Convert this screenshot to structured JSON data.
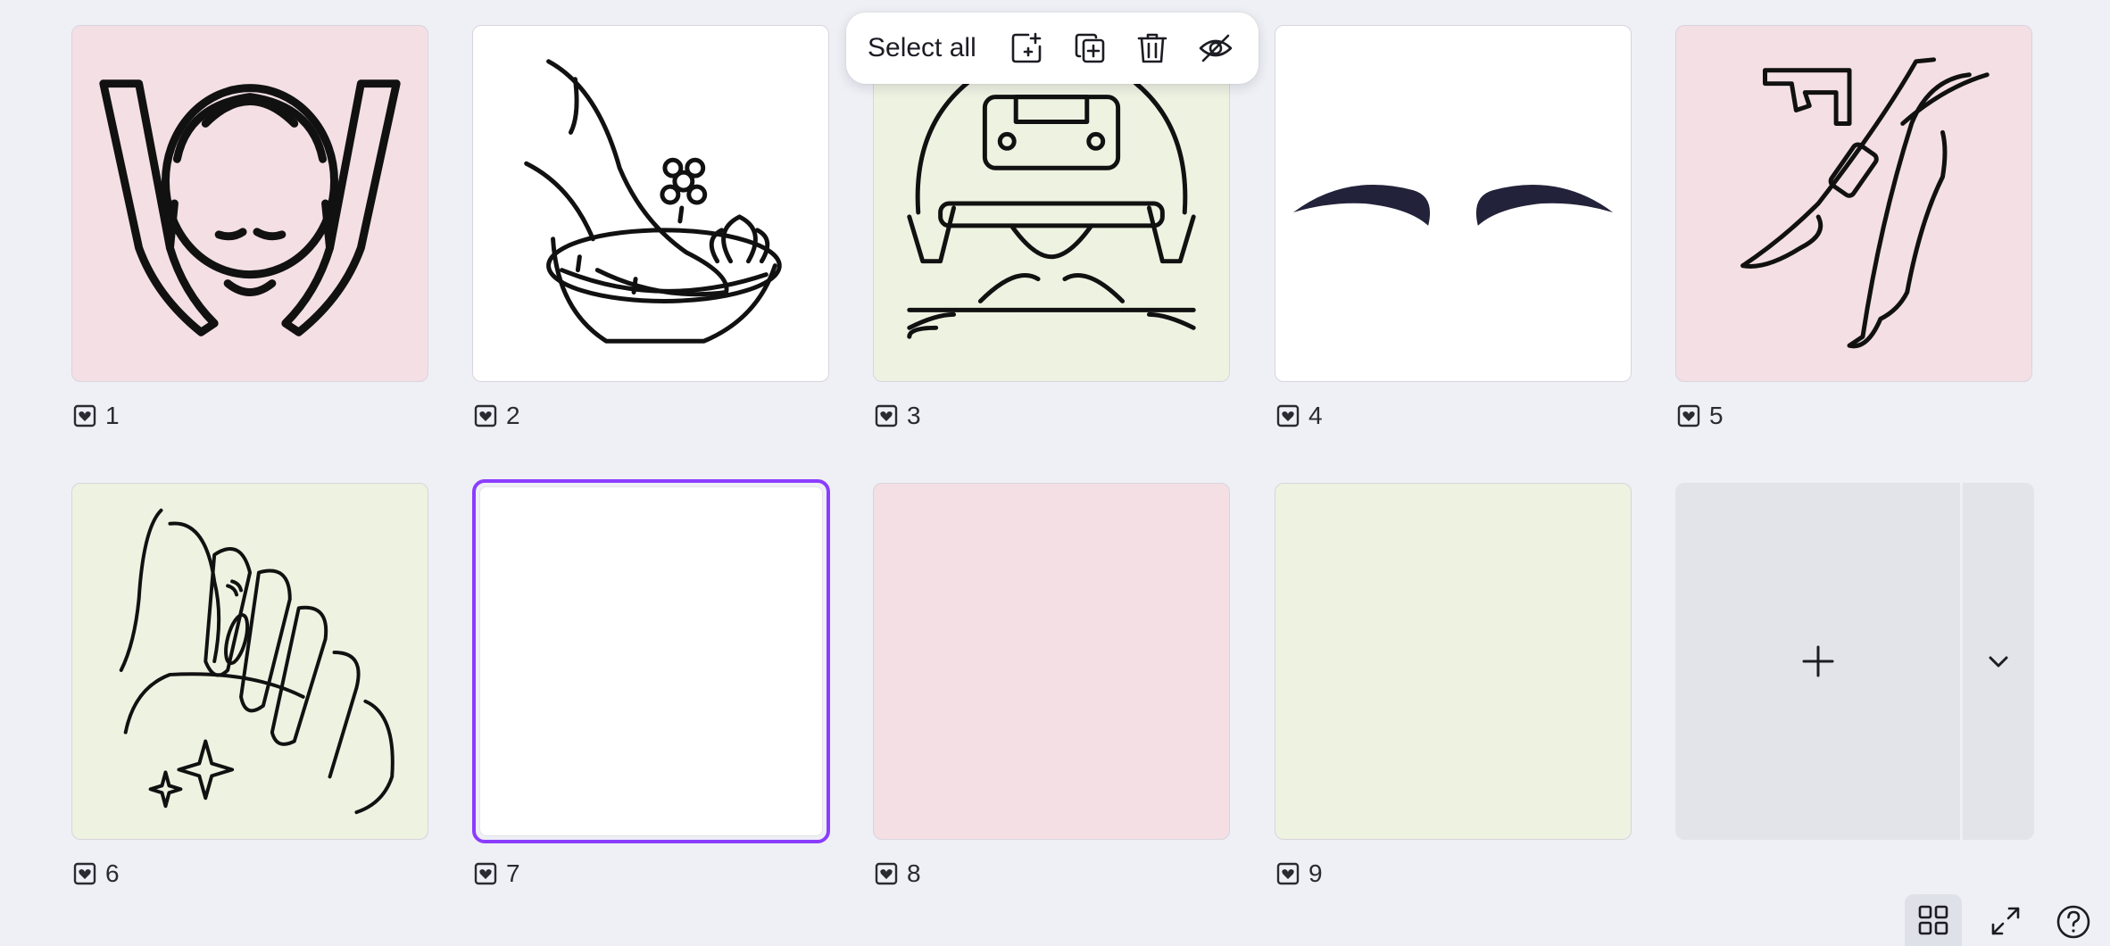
{
  "toolbar": {
    "select_all_label": "Select all",
    "actions": [
      "add-page-icon",
      "duplicate-icon",
      "trash-icon",
      "hide-icon"
    ]
  },
  "pages": [
    {
      "number": "1",
      "background": "#f3dfe4",
      "illustration": "face-massage"
    },
    {
      "number": "2",
      "background": "#ffffff",
      "illustration": "foot-bath"
    },
    {
      "number": "3",
      "background": "#eef2e1",
      "illustration": "hair-dryer"
    },
    {
      "number": "4",
      "background": "#ffffff",
      "illustration": "eyebrows"
    },
    {
      "number": "5",
      "background": "#f3dfe4",
      "illustration": "leg-waxing"
    },
    {
      "number": "6",
      "background": "#eef2e1",
      "illustration": "manicure"
    },
    {
      "number": "7",
      "background": "#ffffff",
      "illustration": "",
      "selected": true
    },
    {
      "number": "8",
      "background": "#f3dfe4",
      "illustration": ""
    },
    {
      "number": "9",
      "background": "#eef2e1",
      "illustration": ""
    }
  ],
  "colors": {
    "accent": "#8b3dff",
    "pink": "#f3dfe4",
    "green": "#eef2e1",
    "canvas": "#eff0f5"
  },
  "bottom_bar": [
    "grid-view-icon",
    "fullscreen-icon",
    "help-icon"
  ]
}
